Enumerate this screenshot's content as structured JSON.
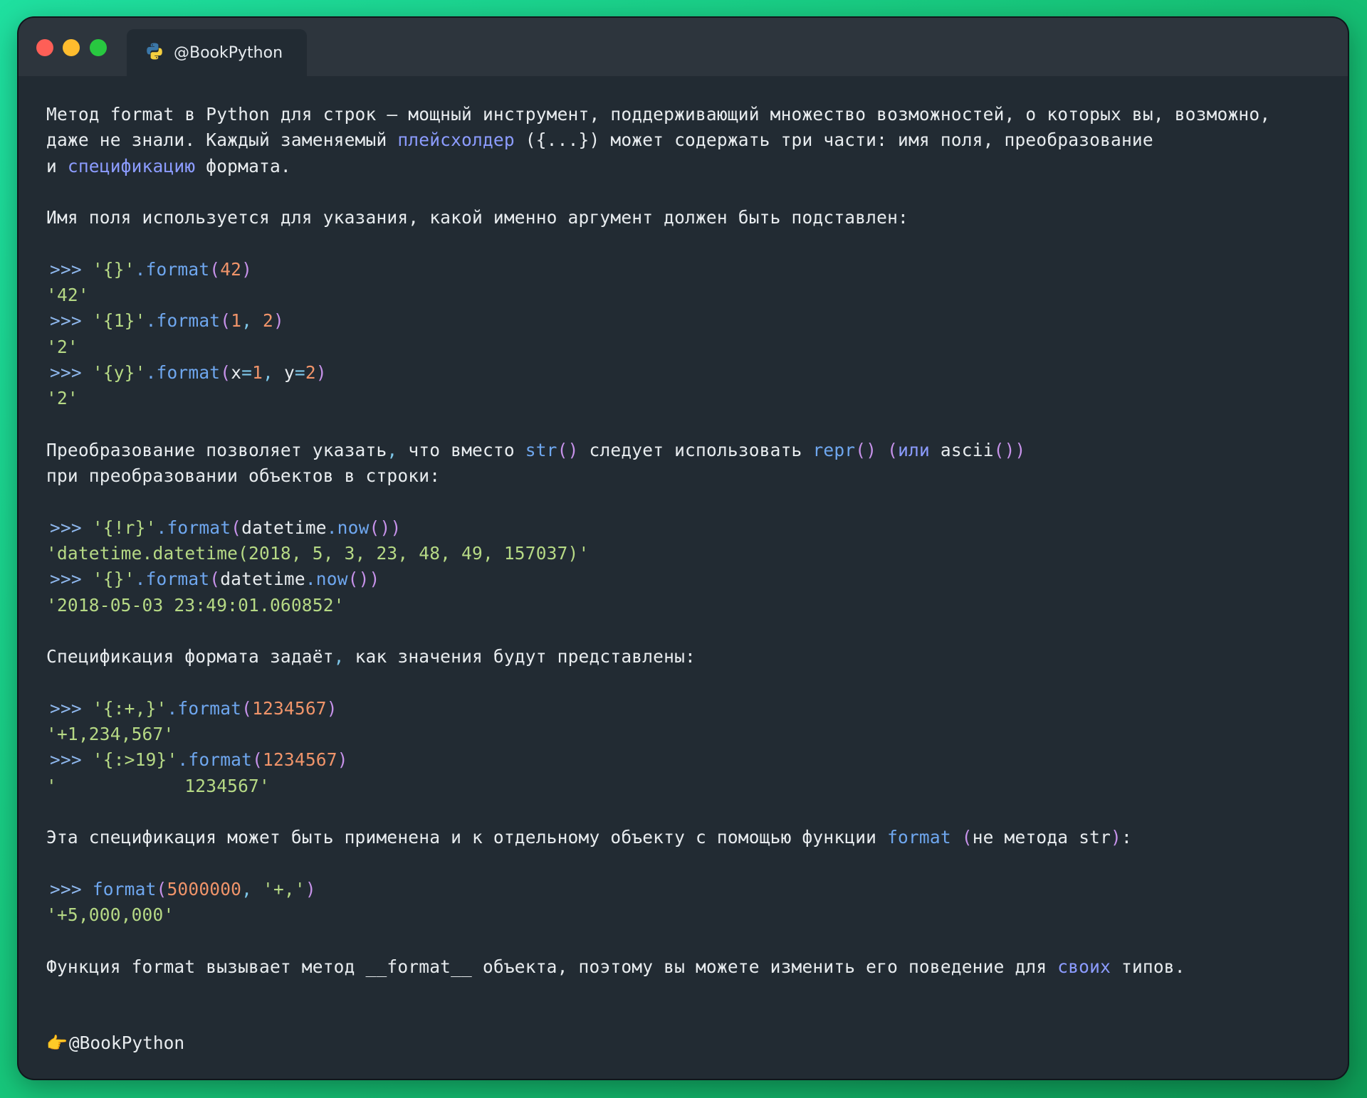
{
  "window": {
    "controls": [
      "close",
      "minimize",
      "maximize"
    ],
    "tab": {
      "label": "@BookPython",
      "icon": "python-logo-icon"
    }
  },
  "content": {
    "para1": {
      "l1": "Метод format в Python для строк — мощный инструмент, поддерживающий множество возможностей, о которых вы, возможно,",
      "l2_a": "даже не знали. Каждый заменяемый ",
      "l2_link": "плейсхолдер",
      "l2_b": " ({...}) может содержать три части: имя поля, преобразование",
      "l3_a": "и ",
      "l3_link": "спецификацию",
      "l3_b": " формата."
    },
    "para2": "Имя поля используется для указания, какой именно аргумент должен быть подставлен:",
    "code1": [
      ">>> '{}'.format(42)",
      "'42'",
      ">>> '{1}'.format(1, 2)",
      "'2'",
      ">>> '{y}'.format(x=1, y=2)",
      "'2'"
    ],
    "para3": {
      "l1": "Преобразование позволяет указать, что вместо str() следует использовать repr() (или ascii())",
      "l2": "при преобразовании объектов в строки:"
    },
    "code2": [
      ">>> '{!r}'.format(datetime.now())",
      "'datetime.datetime(2018, 5, 3, 23, 48, 49, 157037)'",
      ">>> '{}'.format(datetime.now())",
      "'2018-05-03 23:49:01.060852'"
    ],
    "para4": "Спецификация формата задаёт, как значения будут представлены:",
    "code3": [
      ">>> '{:+,}'.format(1234567)",
      "'+1,234,567'",
      ">>> '{:>19}'.format(1234567)",
      "'            1234567'"
    ],
    "para5": "Эта спецификация может быть применена и к отдельному объекту с помощью функции format (не метода str):",
    "code4": [
      ">>> format(5000000, '+,')",
      "'+5,000,000'"
    ],
    "para6": {
      "a": "Функция format вызывает метод __format__ объекта, поэтому вы можете изменить его поведение для ",
      "link": "своих",
      "b": " типов."
    }
  },
  "signature": {
    "icon": "pointing-hand-icon",
    "text": "@BookPython"
  },
  "colors": {
    "background": "#222b33",
    "titlebar": "#2d353d",
    "text": "#e8ecef",
    "prompt": "#8fb8ee",
    "string": "#b6d985",
    "number": "#f0946a",
    "method": "#6fa7ef",
    "bracket": "#c792ea",
    "highlight": "#8c9cff"
  }
}
